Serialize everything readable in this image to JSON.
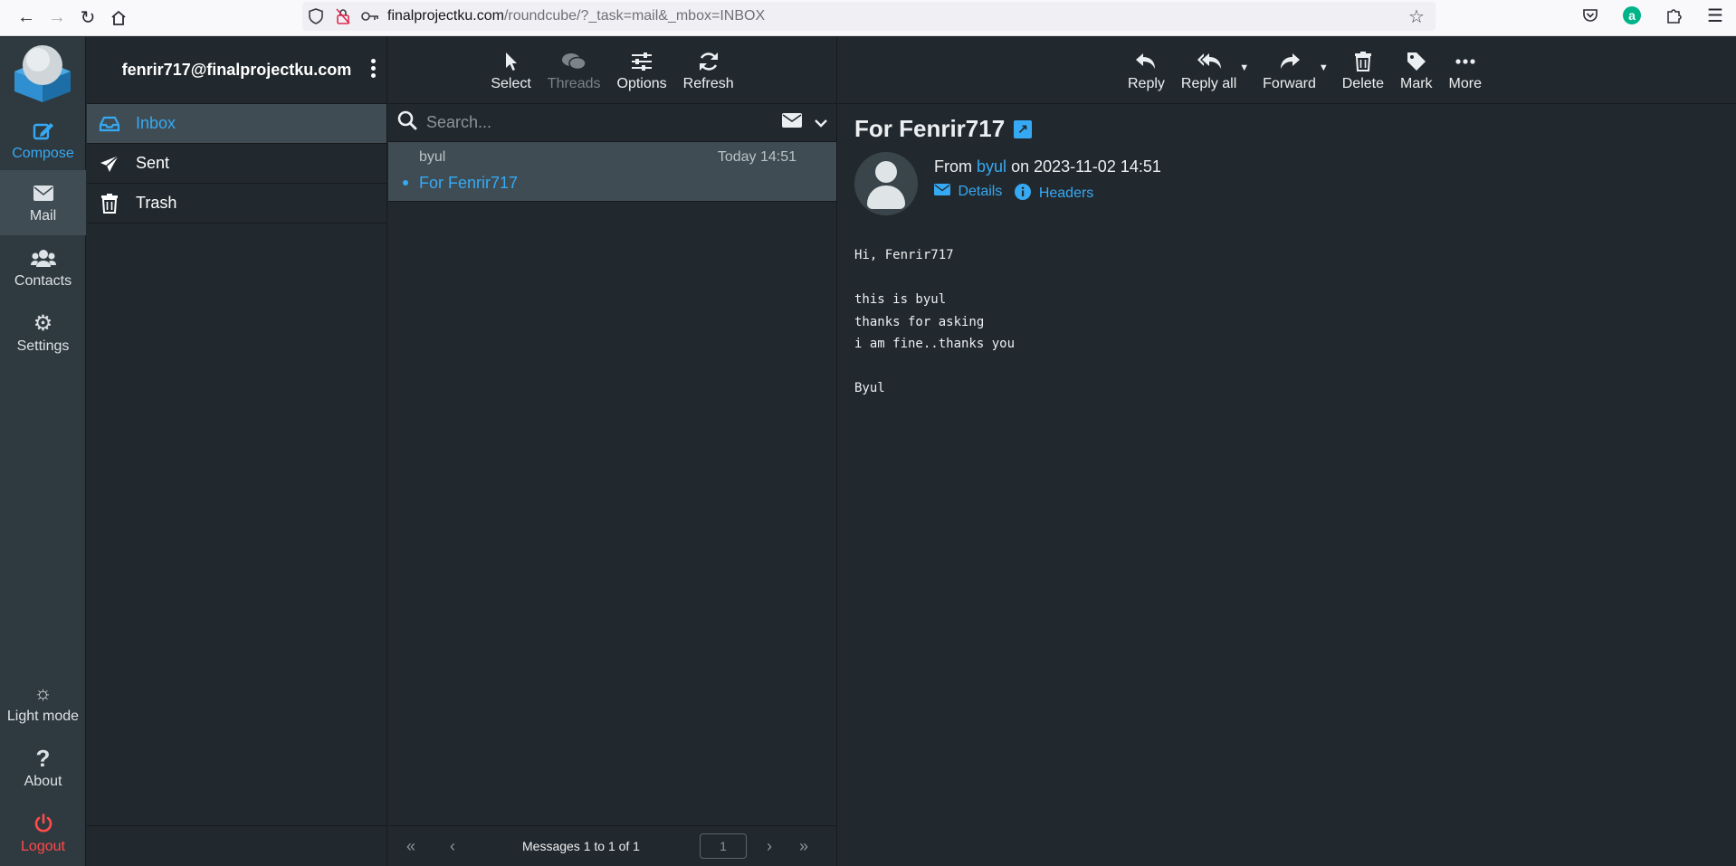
{
  "browser": {
    "url_host": "finalprojectku.com",
    "url_path": "/roundcube/?_task=mail&_mbox=INBOX"
  },
  "leftnav": {
    "compose": "Compose",
    "mail": "Mail",
    "contacts": "Contacts",
    "settings": "Settings",
    "light_mode": "Light mode",
    "about": "About",
    "logout": "Logout"
  },
  "folders": {
    "account": "fenrir717@finalprojectku.com",
    "items": [
      {
        "label": "Inbox",
        "icon": "inbox-icon"
      },
      {
        "label": "Sent",
        "icon": "paper-plane-icon"
      },
      {
        "label": "Trash",
        "icon": "trash-icon"
      }
    ]
  },
  "list_toolbar": {
    "select": "Select",
    "threads": "Threads",
    "options": "Options",
    "refresh": "Refresh"
  },
  "search": {
    "placeholder": "Search..."
  },
  "messages": [
    {
      "from": "byul",
      "date": "Today 14:51",
      "subject": "For Fenrir717"
    }
  ],
  "pagination": {
    "text": "Messages 1 to 1 of 1",
    "page": "1"
  },
  "view_toolbar": {
    "reply": "Reply",
    "reply_all": "Reply all",
    "forward": "Forward",
    "delete": "Delete",
    "mark": "Mark",
    "more": "More"
  },
  "message": {
    "subject": "For Fenrir717",
    "from_prefix": "From",
    "from_name": "byul",
    "on_text": "on 2023-11-02 14:51",
    "details": "Details",
    "headers": "Headers",
    "body": "Hi, Fenrir717\n\nthis is byul\nthanks for asking\ni am fine..thanks you\n\nByul"
  },
  "colors": {
    "accent": "#36a9f4",
    "logout": "#ff4a4a",
    "background": "#22292e"
  }
}
